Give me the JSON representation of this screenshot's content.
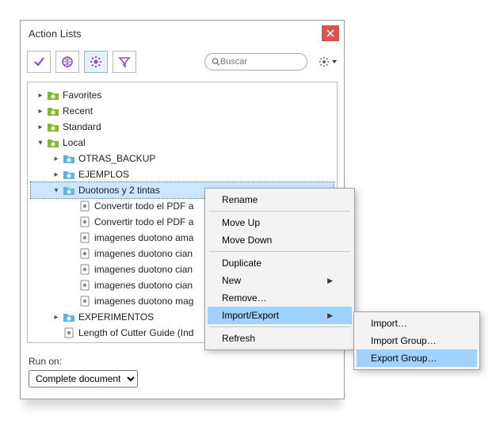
{
  "colors": {
    "accent": "#8a4bca",
    "folder_green": "#84b92c",
    "folder_blue": "#5eb6e4",
    "highlight": "#9fd2ff",
    "close": "#d9534f"
  },
  "window": {
    "title": "Action Lists"
  },
  "search": {
    "placeholder": "Buscar"
  },
  "tree": {
    "favorites": "Favorites",
    "recent": "Recent",
    "standard": "Standard",
    "local": "Local",
    "otras_backup": "OTRAS_BACKUP",
    "ejemplos": "EJEMPLOS",
    "duotonos": "Duotonos y 2 tintas",
    "item1": "Convertir todo el PDF a",
    "item2": "Convertir todo el PDF a",
    "item3": "imagenes duotono ama",
    "item4": "imagenes duotono cian",
    "item5": "imagenes duotono cian",
    "item6": "imagenes duotono cian",
    "item7": "imagenes duotono mag",
    "experimentos": "EXPERIMENTOS",
    "cutter": "Length of Cutter Guide (Ind"
  },
  "runon": {
    "label": "Run on:",
    "value": "Complete document"
  },
  "context_menu": {
    "rename": "Rename",
    "moveup": "Move Up",
    "movedown": "Move Down",
    "duplicate": "Duplicate",
    "new": "New",
    "remove": "Remove…",
    "importexport": "Import/Export",
    "refresh": "Refresh"
  },
  "submenu": {
    "import": "Import…",
    "import_group": "Import Group…",
    "export_group": "Export Group…"
  }
}
